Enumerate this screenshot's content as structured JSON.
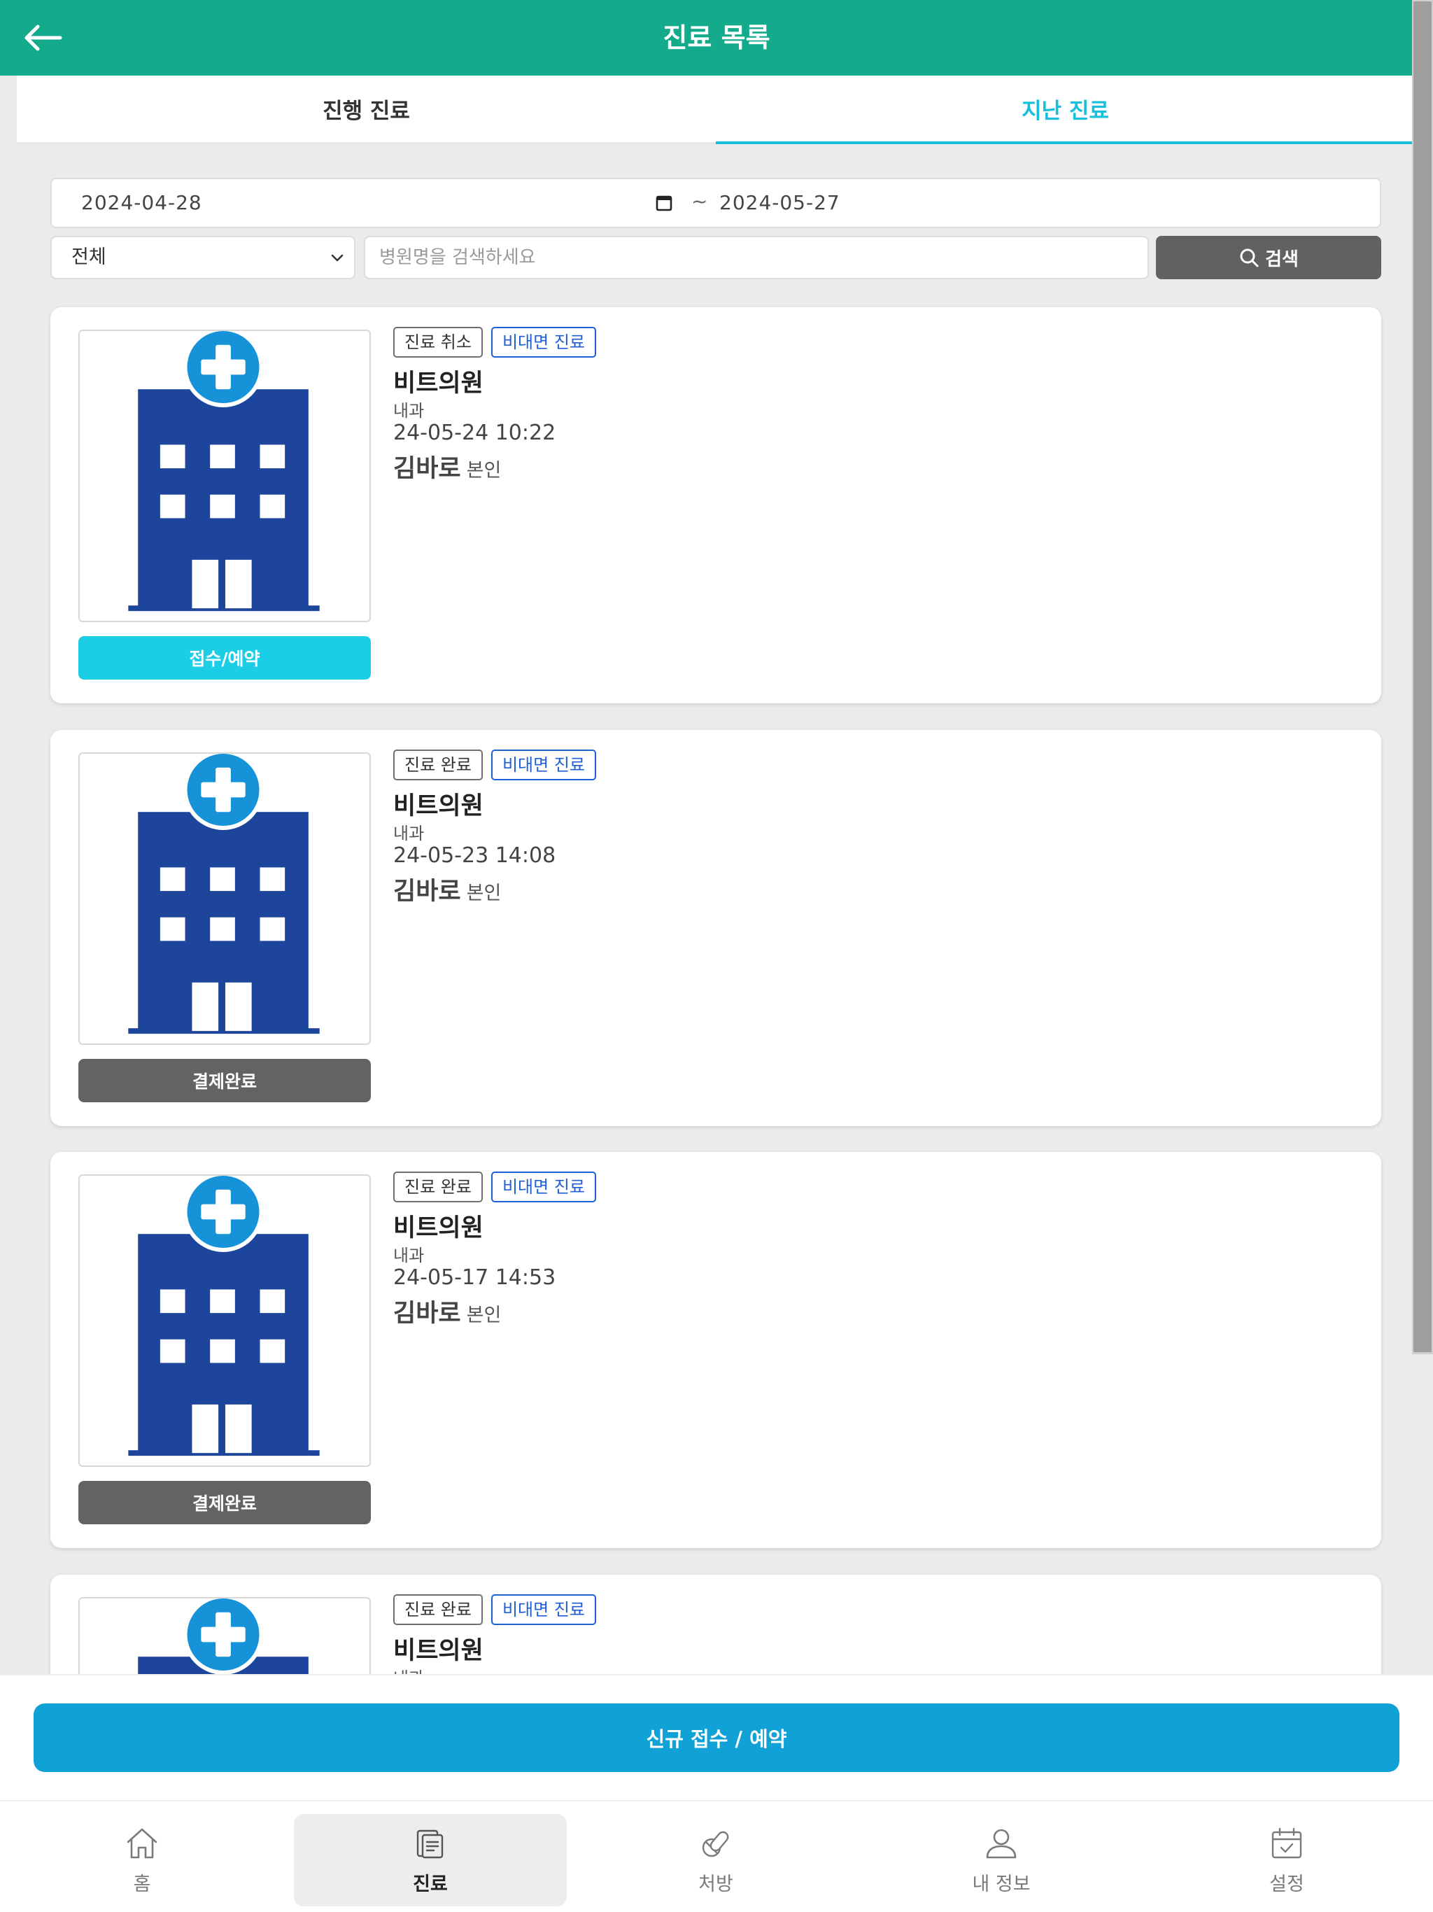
{
  "header": {
    "title": "진료 목록",
    "back_icon": "arrow-left-icon"
  },
  "tabs": [
    {
      "label": "진행 진료",
      "active": false
    },
    {
      "label": "지난 진료",
      "active": true
    }
  ],
  "filter": {
    "date_start": "2024-04-28",
    "date_separator": "~",
    "date_end": "2024-05-27",
    "select_value": "전체",
    "search_placeholder": "병원명을 검색하세요",
    "search_value": "",
    "search_button_label": "검색"
  },
  "records": [
    {
      "status_tag": "진료 취소",
      "type_tag": "비대면 진료",
      "hospital": "비트의원",
      "department": "내과",
      "datetime": "24-05-24 10:22",
      "patient": "김바로",
      "relation": "본인",
      "action_label": "접수/예약",
      "action_kind": "reserve"
    },
    {
      "status_tag": "진료 완료",
      "type_tag": "비대면 진료",
      "hospital": "비트의원",
      "department": "내과",
      "datetime": "24-05-23 14:08",
      "patient": "김바로",
      "relation": "본인",
      "action_label": "결제완료",
      "action_kind": "paid"
    },
    {
      "status_tag": "진료 완료",
      "type_tag": "비대면 진료",
      "hospital": "비트의원",
      "department": "내과",
      "datetime": "24-05-17 14:53",
      "patient": "김바로",
      "relation": "본인",
      "action_label": "결제완료",
      "action_kind": "paid"
    },
    {
      "status_tag": "진료 완료",
      "type_tag": "비대면 진료",
      "hospital": "비트의원",
      "department": "내과",
      "datetime": "",
      "patient": "",
      "relation": "",
      "action_label": "",
      "action_kind": ""
    }
  ],
  "cta": {
    "label": "신규 접수 / 예약"
  },
  "bottom_nav": [
    {
      "label": "홈",
      "icon": "home-icon",
      "active": false
    },
    {
      "label": "진료",
      "icon": "document-icon",
      "active": true
    },
    {
      "label": "처방",
      "icon": "pill-icon",
      "active": false
    },
    {
      "label": "내 정보",
      "icon": "user-icon",
      "active": false
    },
    {
      "label": "설정",
      "icon": "calendar-check-icon",
      "active": false
    }
  ],
  "colors": {
    "header_bg": "#14aa8c",
    "active_tab": "#17bfdc",
    "reserve_button": "#1ccde6",
    "paid_button": "#636363",
    "cta_button": "#10a2d6",
    "hospital_icon_blue": "#1e459c",
    "hospital_cross": "#1592d8"
  }
}
